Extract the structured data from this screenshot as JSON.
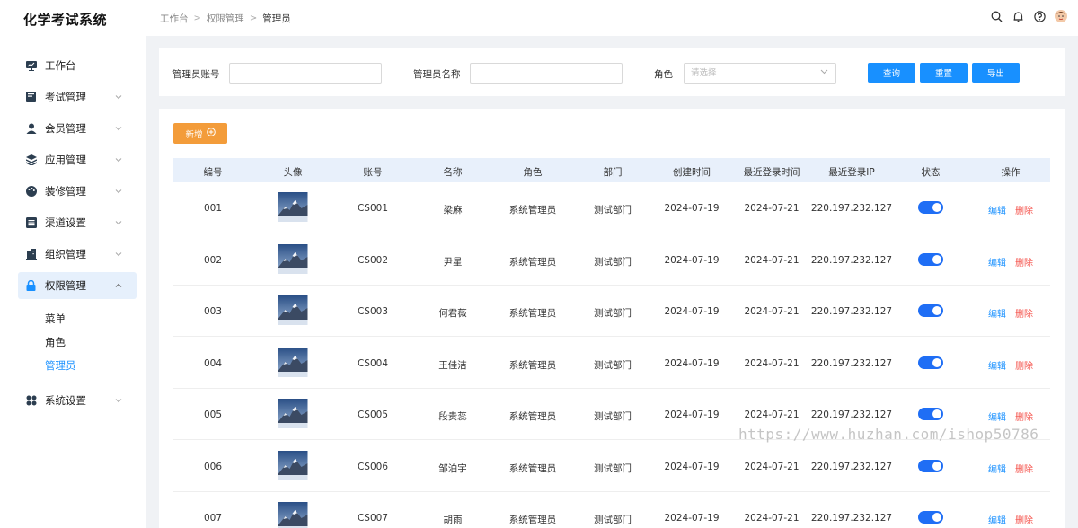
{
  "app": {
    "title": "化学考试系统"
  },
  "sidebar": {
    "items": [
      {
        "label": "工作台",
        "icon": "monitor-icon"
      },
      {
        "label": "考试管理",
        "icon": "book-icon"
      },
      {
        "label": "会员管理",
        "icon": "user-icon"
      },
      {
        "label": "应用管理",
        "icon": "layers-icon"
      },
      {
        "label": "装修管理",
        "icon": "palette-icon"
      },
      {
        "label": "渠道设置",
        "icon": "list-icon"
      },
      {
        "label": "组织管理",
        "icon": "org-icon"
      },
      {
        "label": "权限管理",
        "icon": "lock-icon"
      },
      {
        "label": "系统设置",
        "icon": "grid-icon"
      }
    ],
    "sub_items": [
      "菜单",
      "角色",
      "管理员"
    ]
  },
  "header": {
    "breadcrumb": [
      "工作台",
      "权限管理",
      "管理员"
    ],
    "icons": [
      "search-icon",
      "bell-icon",
      "help-icon",
      "avatar"
    ]
  },
  "search": {
    "account_label": "管理员账号",
    "name_label": "管理员名称",
    "role_label": "角色",
    "role_placeholder": "请选择",
    "query_button": "查询",
    "reset_button": "重置",
    "export_button": "导出"
  },
  "table": {
    "add_button": "新增",
    "columns": [
      "编号",
      "头像",
      "账号",
      "名称",
      "角色",
      "部门",
      "创建时间",
      "最近登录时间",
      "最近登录IP",
      "状态",
      "操作"
    ],
    "edit_label": "编辑",
    "delete_label": "删除",
    "rows": [
      {
        "id": "001",
        "account": "CS001",
        "name": "梁麻",
        "role": "系统管理员",
        "dept": "测试部门",
        "created": "2024-07-19",
        "last_login": "2024-07-21",
        "ip": "220.197.232.127",
        "status": true
      },
      {
        "id": "002",
        "account": "CS002",
        "name": "尹星",
        "role": "系统管理员",
        "dept": "测试部门",
        "created": "2024-07-19",
        "last_login": "2024-07-21",
        "ip": "220.197.232.127",
        "status": true
      },
      {
        "id": "003",
        "account": "CS003",
        "name": "何君薇",
        "role": "系统管理员",
        "dept": "测试部门",
        "created": "2024-07-19",
        "last_login": "2024-07-21",
        "ip": "220.197.232.127",
        "status": true
      },
      {
        "id": "004",
        "account": "CS004",
        "name": "王佳洁",
        "role": "系统管理员",
        "dept": "测试部门",
        "created": "2024-07-19",
        "last_login": "2024-07-21",
        "ip": "220.197.232.127",
        "status": true
      },
      {
        "id": "005",
        "account": "CS005",
        "name": "段贵蕊",
        "role": "系统管理员",
        "dept": "测试部门",
        "created": "2024-07-19",
        "last_login": "2024-07-21",
        "ip": "220.197.232.127",
        "status": true
      },
      {
        "id": "006",
        "account": "CS006",
        "name": "邹泊宇",
        "role": "系统管理员",
        "dept": "测试部门",
        "created": "2024-07-19",
        "last_login": "2024-07-21",
        "ip": "220.197.232.127",
        "status": true
      },
      {
        "id": "007",
        "account": "CS007",
        "name": "胡雨",
        "role": "系统管理员",
        "dept": "测试部门",
        "created": "2024-07-19",
        "last_login": "2024-07-21",
        "ip": "220.197.232.127",
        "status": true
      }
    ]
  },
  "watermark": "https://www.huzhan.com/ishop50786",
  "colors": {
    "primary": "#1890ff",
    "add": "#f39c3a",
    "delete": "#f5564f",
    "toggle": "#1f6ef5"
  }
}
